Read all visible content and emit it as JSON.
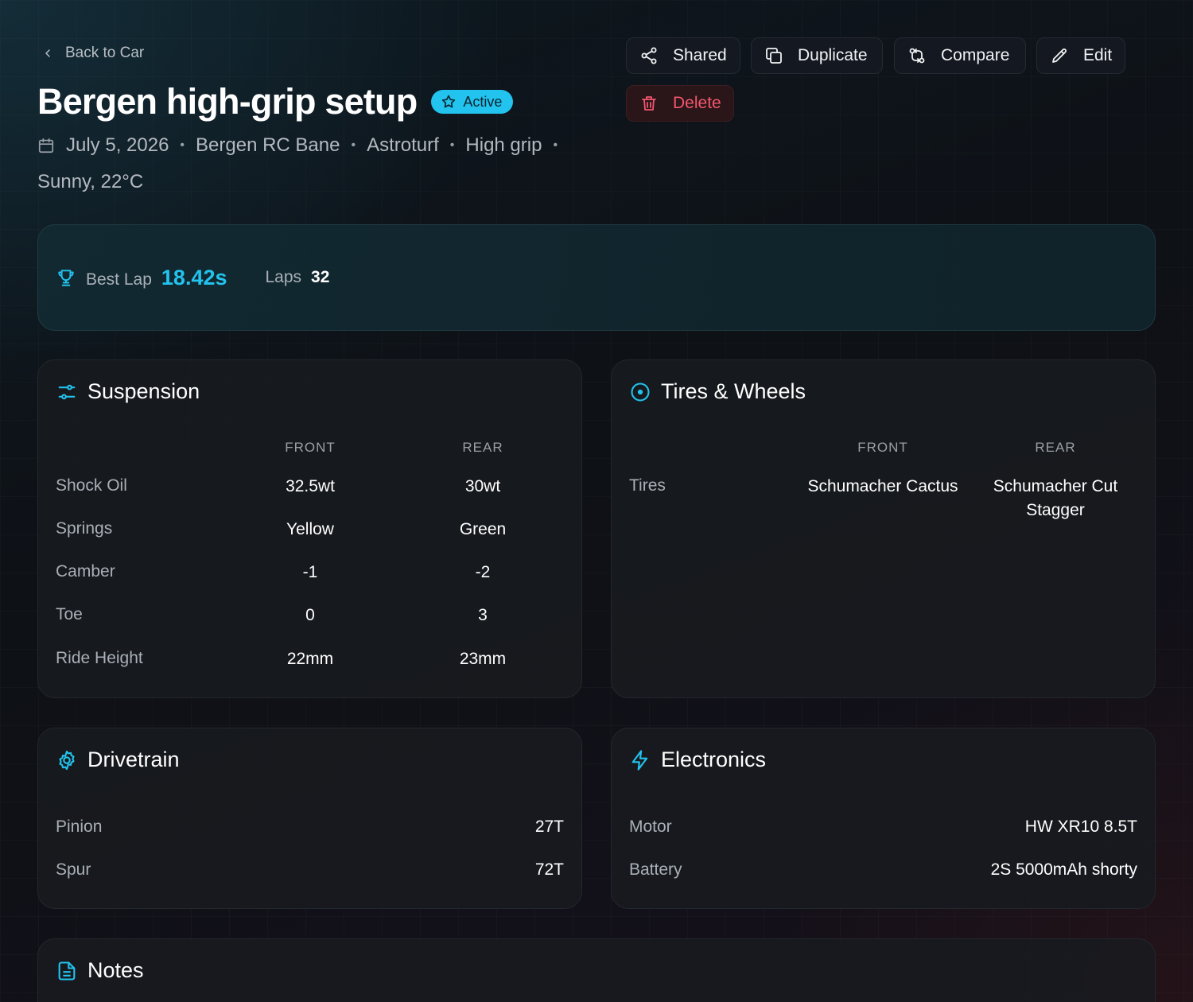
{
  "header": {
    "back_label": "Back to Car",
    "title": "Bergen high-grip setup",
    "badge": "Active",
    "meta": {
      "date": "July 5, 2026",
      "track": "Bergen RC Bane",
      "surface": "Astroturf",
      "grip": "High grip",
      "weather": "Sunny, 22°C"
    }
  },
  "actions": {
    "shared": "Shared",
    "duplicate": "Duplicate",
    "compare": "Compare",
    "edit": "Edit",
    "delete": "Delete"
  },
  "stats": {
    "best_lap_label": "Best Lap",
    "best_lap_value": "18.42s",
    "laps_label": "Laps",
    "laps_value": "32"
  },
  "suspension": {
    "title": "Suspension",
    "col_front": "FRONT",
    "col_rear": "REAR",
    "rows": [
      {
        "label": "Shock Oil",
        "front": "32.5wt",
        "rear": "30wt"
      },
      {
        "label": "Springs",
        "front": "Yellow",
        "rear": "Green"
      },
      {
        "label": "Camber",
        "front": "-1",
        "rear": "-2"
      },
      {
        "label": "Toe",
        "front": "0",
        "rear": "3"
      },
      {
        "label": "Ride Height",
        "front": "22mm",
        "rear": "23mm"
      }
    ]
  },
  "tires": {
    "title": "Tires & Wheels",
    "col_front": "FRONT",
    "col_rear": "REAR",
    "rows": [
      {
        "label": "Tires",
        "front": "Schumacher Cactus",
        "rear": "Schumacher Cut Stagger"
      }
    ]
  },
  "drivetrain": {
    "title": "Drivetrain",
    "rows": [
      {
        "label": "Pinion",
        "value": "27T"
      },
      {
        "label": "Spur",
        "value": "72T"
      }
    ]
  },
  "electronics": {
    "title": "Electronics",
    "rows": [
      {
        "label": "Motor",
        "value": "HW XR10 8.5T"
      },
      {
        "label": "Battery",
        "value": "2S 5000mAh shorty"
      }
    ]
  },
  "notes": {
    "title": "Notes"
  },
  "colors": {
    "accent": "#22c3ee",
    "danger": "#f2576e",
    "background": "#0e1116"
  }
}
